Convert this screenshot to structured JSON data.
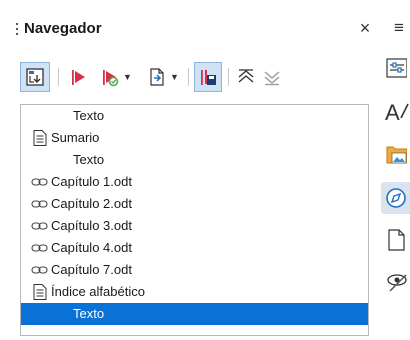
{
  "panel": {
    "title": "Navegador",
    "close_glyph": "×",
    "menu_glyph": "≡"
  },
  "toolbar": {
    "buttons": [
      {
        "icon": "content-view-toggle-icon",
        "active": true
      },
      {
        "icon": "navigate-prev-icon",
        "active": false
      },
      {
        "icon": "navigate-next-icon",
        "active": false,
        "dropdown": true
      },
      {
        "icon": "drag-mode-icon",
        "active": false,
        "dropdown": true
      },
      {
        "icon": "save-contents-as-icon",
        "active": true
      },
      {
        "icon": "promote-chapter-icon",
        "active": false
      },
      {
        "icon": "demote-chapter-icon",
        "active": false
      }
    ]
  },
  "tree": {
    "items": [
      {
        "label": "Texto",
        "icon": "none",
        "indent": true,
        "selected": false
      },
      {
        "label": "Sumario",
        "icon": "index-document-icon",
        "indent": false,
        "selected": false
      },
      {
        "label": "Texto",
        "icon": "none",
        "indent": true,
        "selected": false
      },
      {
        "label": "Capítulo 1.odt",
        "icon": "link-icon",
        "indent": false,
        "selected": false
      },
      {
        "label": "Capítulo 2.odt",
        "icon": "link-icon",
        "indent": false,
        "selected": false
      },
      {
        "label": "Capítulo 3.odt",
        "icon": "link-icon",
        "indent": false,
        "selected": false
      },
      {
        "label": "Capítulo 4.odt",
        "icon": "link-icon",
        "indent": false,
        "selected": false
      },
      {
        "label": "Capítulo 7.odt",
        "icon": "link-icon",
        "indent": false,
        "selected": false
      },
      {
        "label": "Índice alfabético",
        "icon": "index-document-icon",
        "indent": false,
        "selected": false
      },
      {
        "label": "Texto",
        "icon": "none",
        "indent": true,
        "selected": true
      }
    ]
  },
  "sidebar": {
    "items": [
      {
        "icon": "properties-icon",
        "active": false
      },
      {
        "icon": "styles-icon",
        "active": false
      },
      {
        "icon": "gallery-icon",
        "active": false
      },
      {
        "icon": "navigator-icon",
        "active": true
      },
      {
        "icon": "page-icon",
        "active": false
      },
      {
        "icon": "style-inspector-icon",
        "active": false
      }
    ]
  },
  "colors": {
    "selection": "#0a72d6",
    "active_toolbar_bg": "#cfe3f6",
    "accent_red": "#d9304a",
    "accent_green": "#4caf50",
    "accent_blue": "#1e73c8"
  }
}
